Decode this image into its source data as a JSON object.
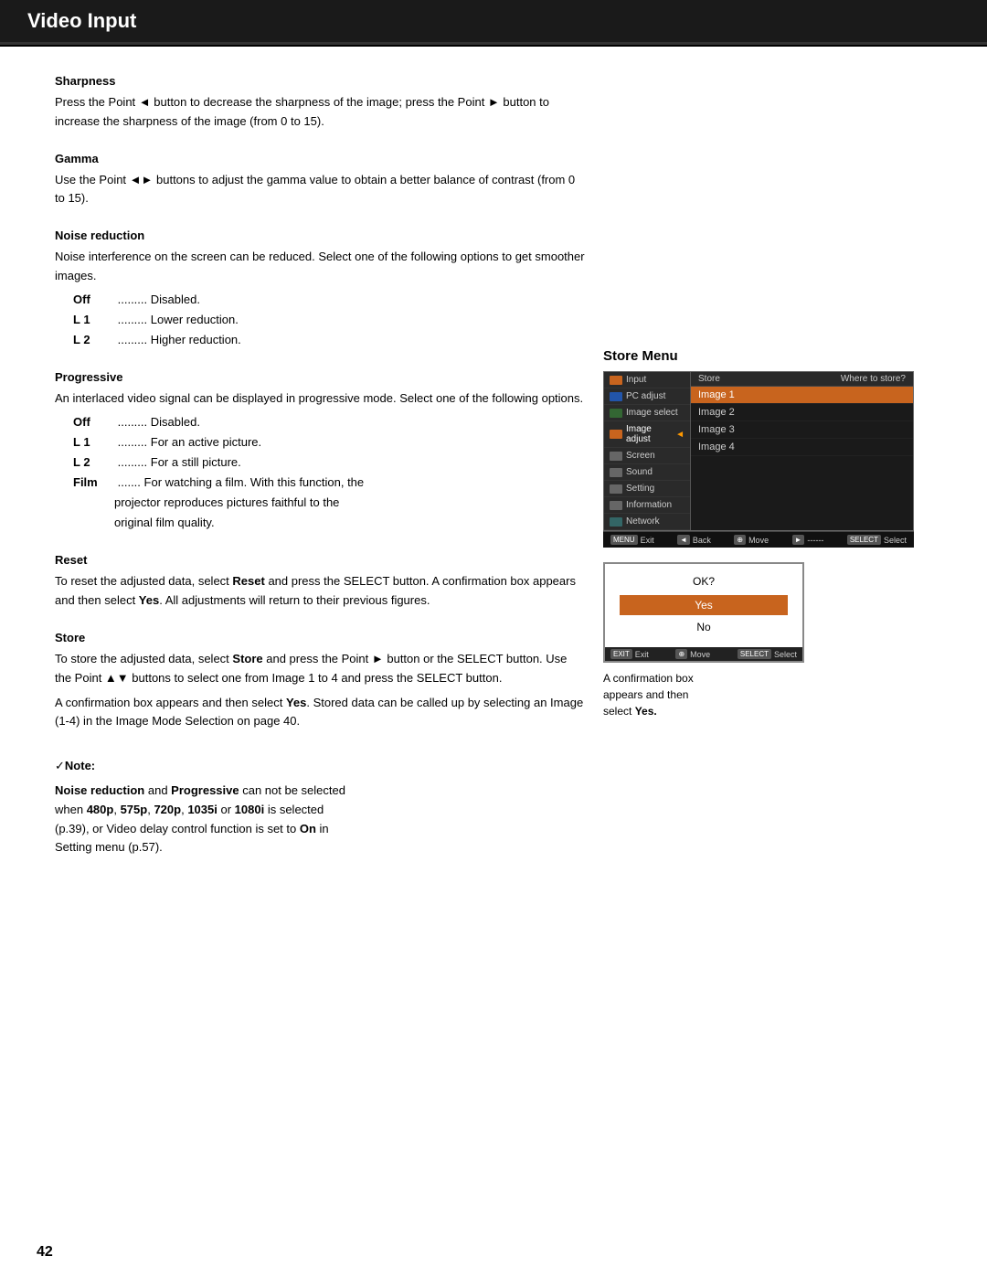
{
  "header": {
    "title": "Video Input"
  },
  "page_number": "42",
  "sections": {
    "sharpness": {
      "title": "Sharpness",
      "body": "Press the Point ◄ button to decrease the sharpness of the image; press the Point ► button to increase the sharpness of the image (from 0 to 15)."
    },
    "gamma": {
      "title": "Gamma",
      "body": "Use the Point ◄► buttons to adjust the gamma value to obtain a better balance of contrast (from 0 to 15)."
    },
    "noise_reduction": {
      "title": "Noise reduction",
      "body": "Noise interference on the screen can be reduced. Select one of the following options to get smoother images.",
      "items": [
        {
          "label": "Off",
          "dots": ".........",
          "desc": "Disabled."
        },
        {
          "label": "L 1",
          "dots": ".........",
          "desc": "Lower reduction."
        },
        {
          "label": "L 2",
          "dots": ".........",
          "desc": "Higher reduction."
        }
      ]
    },
    "progressive": {
      "title": "Progressive",
      "body": "An interlaced video signal can be displayed in progressive mode. Select one of the following options.",
      "items": [
        {
          "label": "Off",
          "dots": ".........",
          "desc": "Disabled."
        },
        {
          "label": "L 1",
          "dots": ".........",
          "desc": "For an active picture."
        },
        {
          "label": "L 2",
          "dots": ".........",
          "desc": "For a still picture."
        },
        {
          "label": "Film",
          "dots": ".......",
          "desc": "For watching a film. With this function, the"
        }
      ],
      "film_extra_lines": [
        "projector reproduces pictures faithful to the",
        "original film quality."
      ]
    },
    "reset": {
      "title": "Reset",
      "body": "To reset the adjusted data, select Reset and press the SELECT button. A confirmation box appears and then select Yes. All adjustments will return to their previous figures."
    },
    "store": {
      "title": "Store",
      "body1": "To store the adjusted data, select Store and press the Point ► button or the SELECT button. Use the Point ▲▼ buttons to select one from Image 1 to 4 and press the SELECT button.",
      "body2": "A confirmation box appears and then select Yes. Stored data can be called up by selecting an Image (1-4) in the Image Mode Selection on page 40."
    },
    "note": {
      "prefix": "✓",
      "title": "Note:",
      "line1_bold1": "Noise reduction",
      "line1_text": " and ",
      "line1_bold2": "Progressive",
      "line1_end": " can not be selected",
      "line2_bold_parts": [
        "480p",
        "575p",
        "720p",
        "1035i",
        "1080i"
      ],
      "line2_text1": "when ",
      "line2_text2": ", ",
      "line2_text3": ", ",
      "line2_text4": ", ",
      "line2_text5": " or ",
      "line2_text6": " is selected",
      "line3": "(p.39), or Video delay control function is set to ",
      "line3_bold": "On",
      "line3_end": " in",
      "line4": "Setting menu (p.57)."
    }
  },
  "store_menu": {
    "label": "Store Menu",
    "osd": {
      "left_items": [
        {
          "name": "Input",
          "color": "orange"
        },
        {
          "name": "PC adjust",
          "color": "blue"
        },
        {
          "name": "Image select",
          "color": "green"
        },
        {
          "name": "Image adjust",
          "color": "orange",
          "active": true
        },
        {
          "name": "Screen",
          "color": "gray"
        },
        {
          "name": "Sound",
          "color": "gray"
        },
        {
          "name": "Setting",
          "color": "gray"
        },
        {
          "name": "Information",
          "color": "gray"
        },
        {
          "name": "Network",
          "color": "gray"
        }
      ],
      "header_left": "Store",
      "header_right": "Where to store?",
      "right_items": [
        {
          "label": "Image 1",
          "highlighted": true
        },
        {
          "label": "Image 2",
          "highlighted": false
        },
        {
          "label": "Image 3",
          "highlighted": false
        },
        {
          "label": "Image 4",
          "highlighted": false
        }
      ],
      "footer_items": [
        {
          "key": "MENU",
          "label": "Exit"
        },
        {
          "key": "◄",
          "label": "Back"
        },
        {
          "key": "⊕",
          "label": "Move"
        },
        {
          "key": "►",
          "label": "------"
        },
        {
          "key": "SELECT",
          "label": "Select"
        }
      ]
    },
    "confirm": {
      "ok_text": "OK?",
      "yes_label": "Yes",
      "no_label": "No",
      "footer_items": [
        {
          "key": "EXIT",
          "label": "Exit"
        },
        {
          "key": "⊕",
          "label": "Move"
        },
        {
          "key": "SELECT",
          "label": "Select"
        }
      ],
      "caption_line1": "A confirmation box",
      "caption_line2": "appears and then",
      "caption_line3": "select Yes."
    }
  }
}
